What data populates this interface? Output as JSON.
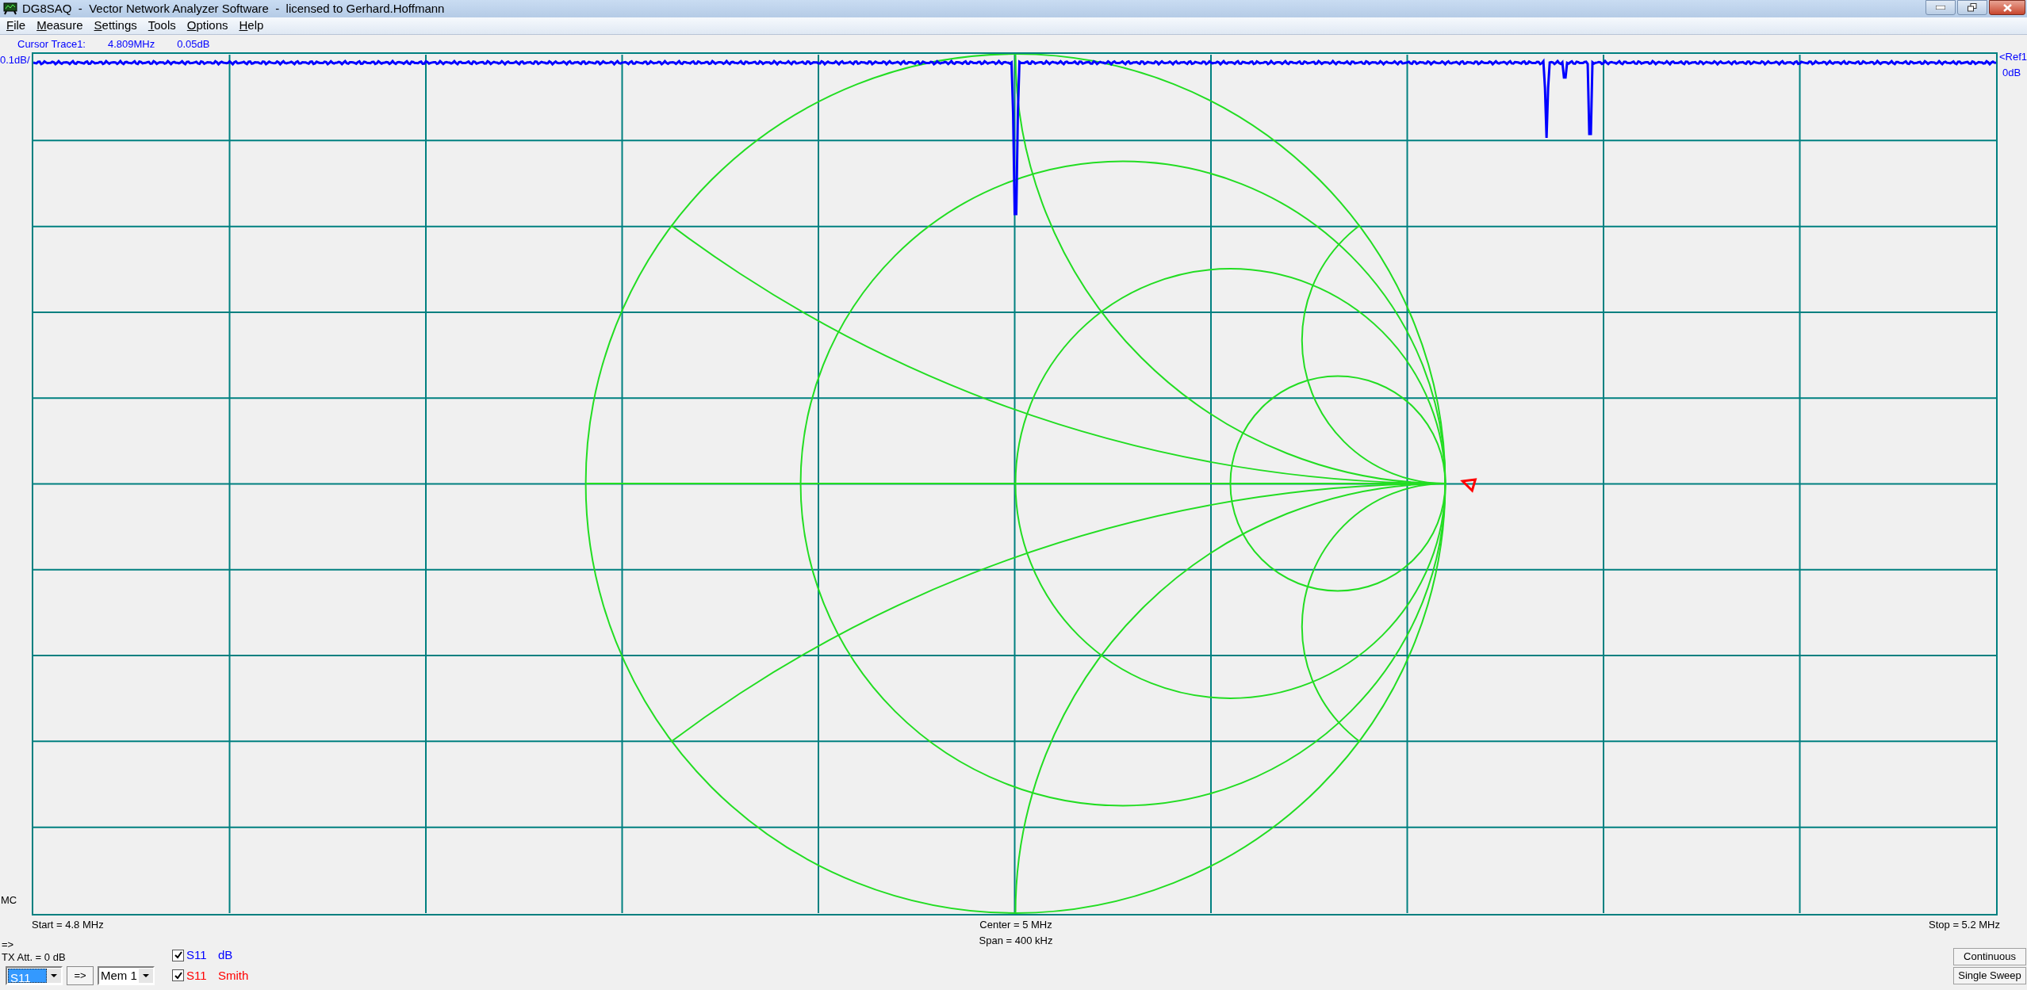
{
  "window": {
    "title": "DG8SAQ  -  Vector Network Analyzer Software  -  licensed to Gerhard.Hoffmann"
  },
  "menu": [
    {
      "label": "File"
    },
    {
      "label": "Measure"
    },
    {
      "label": "Settings"
    },
    {
      "label": "Tools"
    },
    {
      "label": "Options"
    },
    {
      "label": "Help"
    }
  ],
  "cursor": {
    "label": "Cursor Trace1:",
    "frequency": "4.809MHz",
    "value": "0.05dB"
  },
  "plot": {
    "scale_label": "0.1dB/",
    "ref_label": "<Ref1",
    "ref_value": "0dB",
    "marker_label": "MC",
    "start": "Start = 4.8 MHz",
    "center": "Center = 5 MHz",
    "span": "Span = 400 kHz",
    "stop": "Stop = 5.2 MHz"
  },
  "controls": {
    "arrow": "=>",
    "tx_att": "TX Att. = 0 dB",
    "param_select": "S11",
    "copy_button": "=>",
    "memory_select": "Mem 1",
    "traces": [
      {
        "param": "S11",
        "format": "dB",
        "checked": true,
        "color": "#0000ff"
      },
      {
        "param": "S11",
        "format": "Smith",
        "checked": true,
        "color": "#ff0000"
      }
    ],
    "buttons": [
      "Continuous",
      "Single Sweep"
    ]
  }
}
